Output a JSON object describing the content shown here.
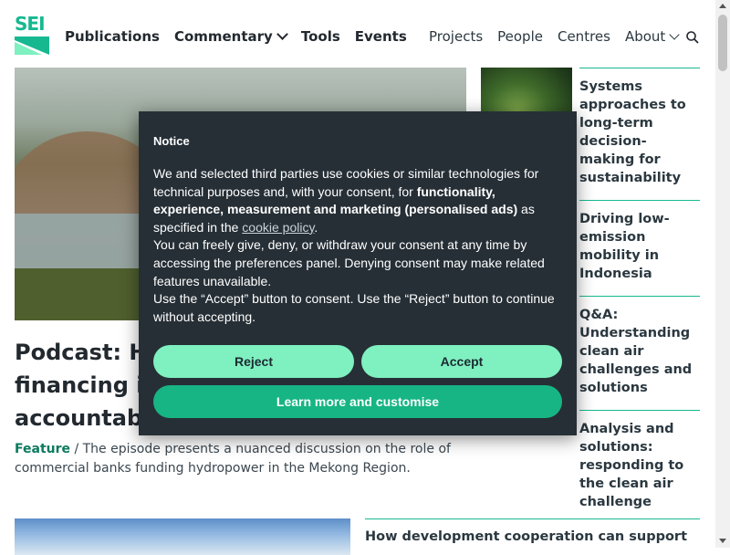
{
  "site": {
    "logo_text": "SEI",
    "accent_color": "#17b890"
  },
  "nav": {
    "primary": [
      "Publications",
      "Commentary",
      "Tools",
      "Events"
    ],
    "secondary": [
      "Projects",
      "People",
      "Centres",
      "About"
    ]
  },
  "feature": {
    "headline_lines": [
      "Podcast: Ho",
      "financing in",
      "accountable"
    ],
    "tag": "Feature",
    "separator": " / ",
    "excerpt": "The episode presents a nuanced discussion on the role of commercial banks funding hydropower in the Mekong Region."
  },
  "sidebar": {
    "items": [
      "Systems approaches to long-term decision-making for sustainability",
      "Driving low-emission mobility in Indonesia",
      "Q&A: Understanding clean air challenges and solutions",
      "Analysis and solutions: responding to the clean air challenge"
    ]
  },
  "bottom": {
    "headline": "How development cooperation can support"
  },
  "notice": {
    "title": "Notice",
    "p1_a": "We and selected third parties use cookies or similar technologies for technical purposes and, with your consent, for ",
    "p1_bold": "functionality, experience, measurement and marketing (personalised ads)",
    "p1_c": " as specified in the ",
    "p1_link": "cookie policy",
    "p1_d": ".",
    "p2": "You can freely give, deny, or withdraw your consent at any time by accessing the preferences panel. Denying consent may make related features unavailable.",
    "p3": "Use the “Accept” button to consent. Use the “Reject” button to continue without accepting.",
    "reject_label": "Reject",
    "accept_label": "Accept",
    "learn_label": "Learn more and customise"
  }
}
